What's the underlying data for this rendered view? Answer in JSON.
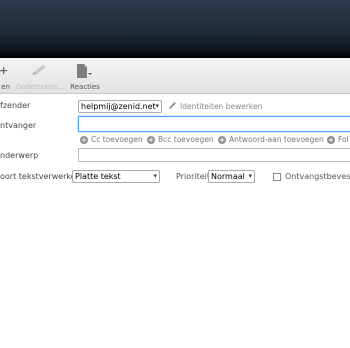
{
  "toolbar": {
    "send_label": "en",
    "signature_label": "Onderteken...",
    "responses_label": "Reacties"
  },
  "compose": {
    "from_label": "fzender",
    "from_value": "helpmij@zenid.net",
    "edit_identities": "Identiteiten bewerken",
    "to_label": "ntvanger",
    "to_value": "",
    "add_cc": "Cc toevoegen",
    "add_bcc": "Bcc toevoegen",
    "add_reply_to": "Antwoord-aan toevoegen",
    "add_followup": "Fol",
    "subject_label": "nderwerp",
    "subject_value": "",
    "editor_type_label": "oort tekstverwerker",
    "editor_type_value": "Platte tekst",
    "priority_label": "Prioriteit",
    "priority_value": "Normaal",
    "receipt_label": "Ontvangstbevestig"
  },
  "colors": {
    "header_dark": "#1f2b39",
    "focus_border": "#4da1ff"
  }
}
